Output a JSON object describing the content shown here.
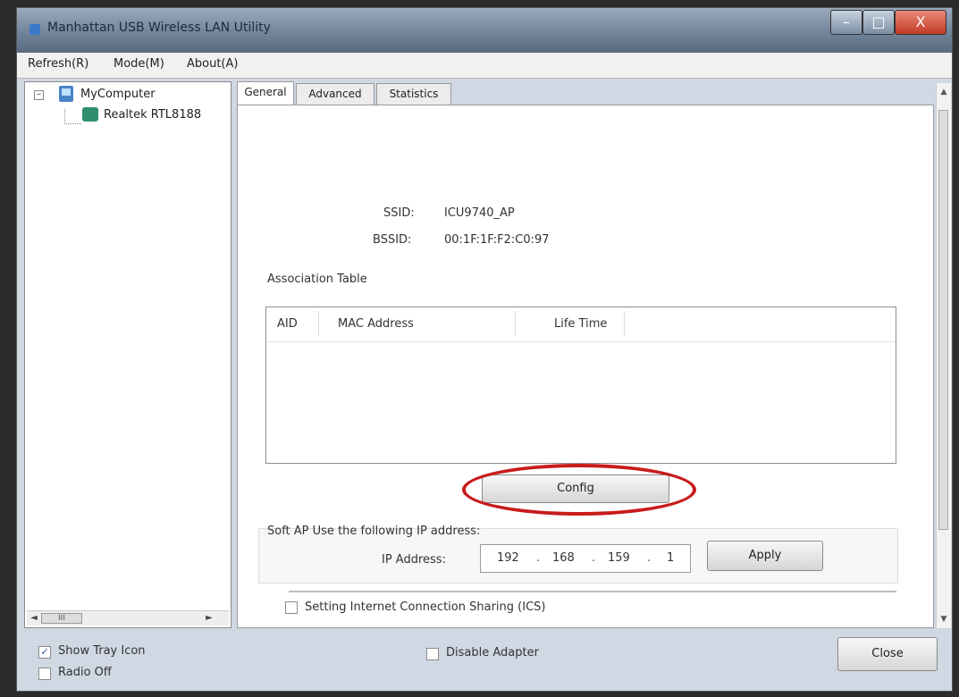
{
  "window": {
    "title": "Manhattan USB Wireless LAN Utility",
    "controls": {
      "minimize": "–",
      "maximize": "□",
      "close": "X"
    }
  },
  "menu": {
    "items": [
      {
        "label": "Refresh(R)"
      },
      {
        "label": "Mode(M)"
      },
      {
        "label": "About(A)"
      }
    ]
  },
  "tree": {
    "expander": "–",
    "root": "MyComputer",
    "child": "Realtek RTL8188",
    "scroll_thumb": "III",
    "scroll_left": "◄",
    "scroll_right": "►"
  },
  "tabs": [
    {
      "label": "General",
      "active": true
    },
    {
      "label": "Advanced",
      "active": false
    },
    {
      "label": "Statistics",
      "active": false
    }
  ],
  "general": {
    "ssid_label": "SSID:",
    "ssid_value": "ICU9740_AP",
    "bssid_label": "BSSID:",
    "bssid_value": "00:1F:1F:F2:C0:97",
    "association_title": "Association Table",
    "table_headers": [
      "AID",
      "MAC Address",
      "Life Time"
    ],
    "config_label": "Config",
    "softap_label": "Soft AP Use the following IP address:",
    "ip_label": "IP Address:",
    "ip_segments": [
      "192",
      "168",
      "159",
      "1"
    ],
    "ip_dot": ".",
    "apply_label": "Apply",
    "ics_label": "Setting Internet Connection Sharing (ICS)",
    "ics_checked": false
  },
  "footer": {
    "show_tray_label": "Show Tray Icon",
    "show_tray_checked": true,
    "check_mark": "✓",
    "radio_off_label": "Radio Off",
    "radio_off_checked": false,
    "disable_adapter_label": "Disable Adapter",
    "disable_adapter_checked": false,
    "close_label": "Close"
  },
  "scroll": {
    "up": "▲",
    "down": "▼"
  },
  "colors": {
    "annotation": "#c81b1b",
    "title_bar": "#6f8197",
    "close_button": "#c23a22"
  }
}
